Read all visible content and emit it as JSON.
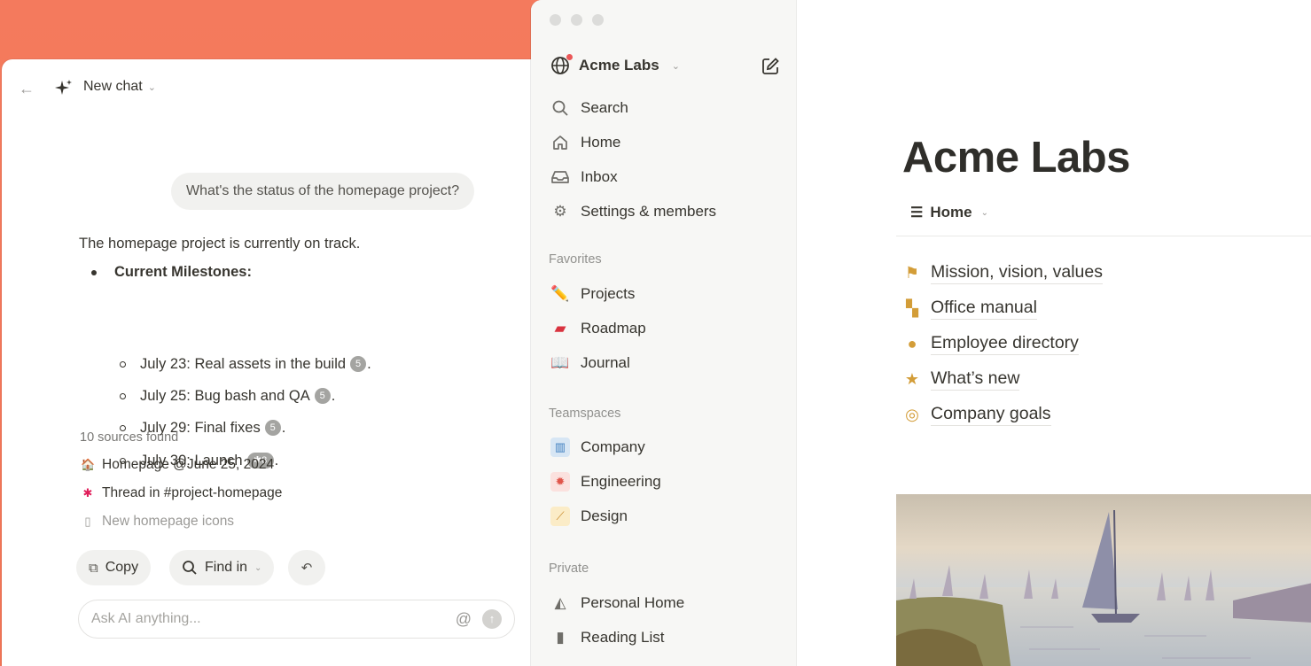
{
  "chat": {
    "title": "New chat",
    "user_message": "What's the status of the homepage project?",
    "answer_intro": "The homepage project is currently on track.",
    "milestones_heading": "Current Milestones:",
    "milestones": [
      {
        "text": "July 23: Real assets in the build",
        "badge": "5"
      },
      {
        "text": "July 25: Bug bash and QA",
        "badge": "5"
      },
      {
        "text": "July 29: Final fixes",
        "badge": "5"
      },
      {
        "text": "July 30: Launch",
        "badge": "8"
      }
    ],
    "sources_label": "10 sources found",
    "sources": [
      {
        "icon": "house-icon",
        "label": "Homepage @June 25, 2024"
      },
      {
        "icon": "slack-icon",
        "label": "Thread in #project-homepage"
      },
      {
        "icon": "document-icon",
        "label": "New homepage icons"
      }
    ],
    "actions": {
      "copy": "Copy",
      "find_in": "Find in"
    },
    "input_placeholder": "Ask AI anything..."
  },
  "sidebar": {
    "workspace": "Acme Labs",
    "nav": [
      {
        "label": "Search",
        "icon": "search-icon"
      },
      {
        "label": "Home",
        "icon": "home-icon"
      },
      {
        "label": "Inbox",
        "icon": "inbox-icon"
      },
      {
        "label": "Settings & members",
        "icon": "gear-icon"
      }
    ],
    "favorites_label": "Favorites",
    "favorites": [
      {
        "label": "Projects",
        "icon": "pencil-icon"
      },
      {
        "label": "Roadmap",
        "icon": "race-car-icon"
      },
      {
        "label": "Journal",
        "icon": "book-icon"
      }
    ],
    "teamspaces_label": "Teamspaces",
    "teamspaces": [
      {
        "label": "Company",
        "icon": "building-icon",
        "color": "#5a8fc4"
      },
      {
        "label": "Engineering",
        "icon": "cog-icon",
        "color": "#e0554a"
      },
      {
        "label": "Design",
        "icon": "paintbrush-icon",
        "color": "#e6a63c"
      }
    ],
    "private_label": "Private",
    "private": [
      {
        "label": "Personal Home",
        "icon": "personal-home-icon"
      },
      {
        "label": "Reading List",
        "icon": "reading-list-icon"
      }
    ]
  },
  "page": {
    "title": "Acme Labs",
    "view_tab": "Home",
    "links": [
      {
        "label": "Mission, vision, values",
        "icon": "flag-icon"
      },
      {
        "label": "Office manual",
        "icon": "open-book-icon"
      },
      {
        "label": "Employee directory",
        "icon": "person-icon"
      },
      {
        "label": "What’s new",
        "icon": "star-icon"
      },
      {
        "label": "Company goals",
        "icon": "target-icon"
      }
    ]
  },
  "colors": {
    "background": "#f4795c",
    "accent_gold": "#d39d38",
    "text": "#37352f"
  }
}
